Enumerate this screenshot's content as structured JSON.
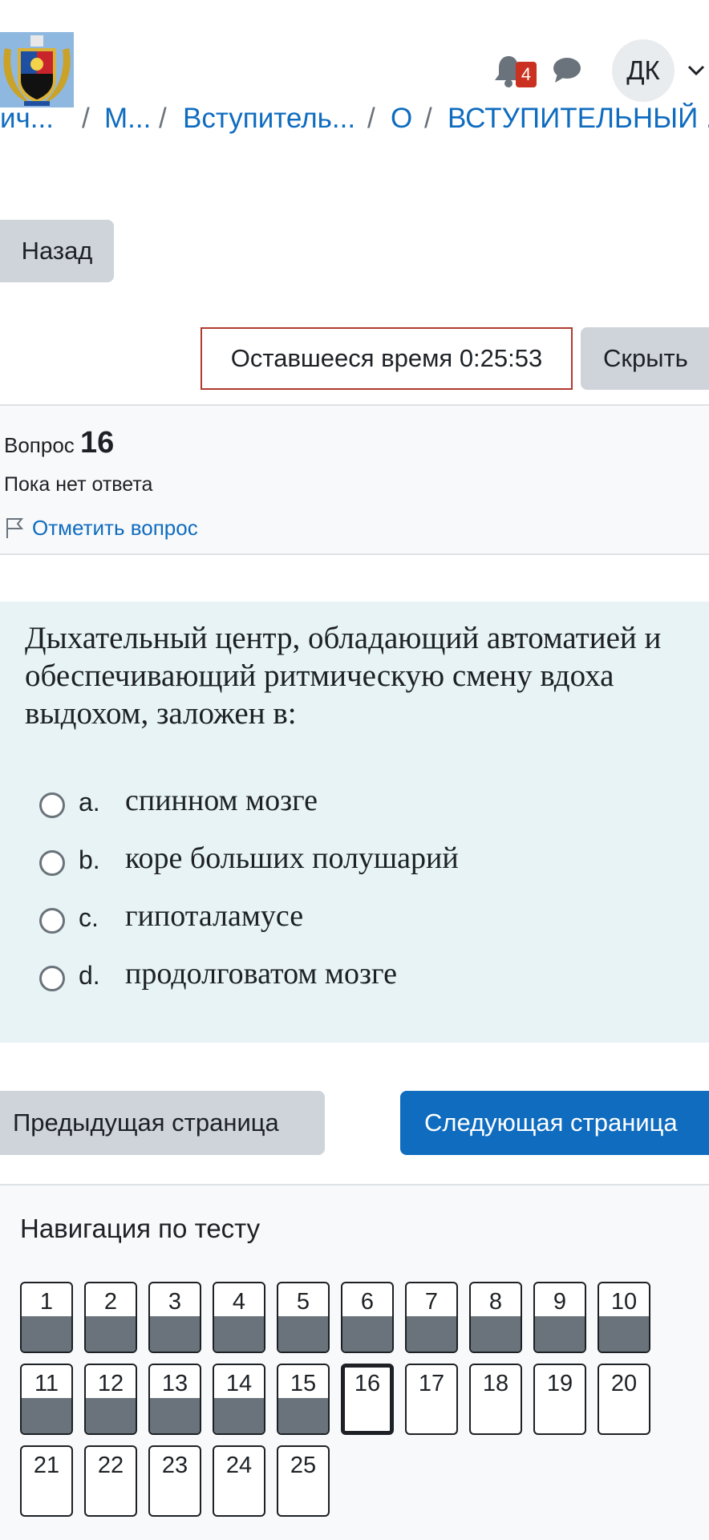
{
  "header": {
    "notifications_count": "4",
    "user_initials": "ДК"
  },
  "breadcrumb": [
    "ич...",
    "/",
    "М...",
    "/",
    "Вступитель...",
    "/",
    "О",
    "/",
    "ВСТУПИТЕЛЬНЫЙ ..."
  ],
  "back_label": "Назад",
  "timer": {
    "text": "Оставшееся время 0:25:53",
    "hide_label": "Скрыть"
  },
  "question_info": {
    "label": "Вопрос",
    "number": "16",
    "state": "Пока нет ответа",
    "flag_label": "Отметить вопрос"
  },
  "question": {
    "text": "Дыхательный центр, обладающий автоматией и обеспечивающий ритмическую смену вдоха выдохом, заложен в:",
    "answers": [
      {
        "letter": "a.",
        "text": "спинном мозге"
      },
      {
        "letter": "b.",
        "text": "коре больших полушарий"
      },
      {
        "letter": "c.",
        "text": "гипоталамусе"
      },
      {
        "letter": "d.",
        "text": "продолговатом мозге"
      }
    ]
  },
  "page_nav": {
    "prev_label": "Предыдущая страница",
    "next_label": "Следующая страница"
  },
  "quiz_nav": {
    "title": "Навигация по тесту",
    "buttons": [
      {
        "label": "1",
        "state": "answered"
      },
      {
        "label": "2",
        "state": "answered"
      },
      {
        "label": "3",
        "state": "answered"
      },
      {
        "label": "4",
        "state": "answered"
      },
      {
        "label": "5",
        "state": "answered"
      },
      {
        "label": "6",
        "state": "answered"
      },
      {
        "label": "7",
        "state": "answered"
      },
      {
        "label": "8",
        "state": "answered"
      },
      {
        "label": "9",
        "state": "answered"
      },
      {
        "label": "10",
        "state": "answered"
      },
      {
        "label": "11",
        "state": "answered"
      },
      {
        "label": "12",
        "state": "answered"
      },
      {
        "label": "13",
        "state": "answered"
      },
      {
        "label": "14",
        "state": "answered"
      },
      {
        "label": "15",
        "state": "answered"
      },
      {
        "label": "16",
        "state": "current"
      },
      {
        "label": "17",
        "state": "unanswered"
      },
      {
        "label": "18",
        "state": "unanswered"
      },
      {
        "label": "19",
        "state": "unanswered"
      },
      {
        "label": "20",
        "state": "unanswered"
      },
      {
        "label": "21",
        "state": "unanswered"
      },
      {
        "label": "22",
        "state": "unanswered"
      },
      {
        "label": "23",
        "state": "unanswered"
      },
      {
        "label": "24",
        "state": "unanswered"
      },
      {
        "label": "25",
        "state": "unanswered"
      }
    ]
  },
  "colors": {
    "brand_blue": "#0f6cbf",
    "badge_red": "#ca3120",
    "question_bg": "#e7f3f5",
    "answered_fill": "#6a737b"
  },
  "icons": [
    "university-logo",
    "bell-icon",
    "chat-icon",
    "chevron-down-icon",
    "flag-icon",
    "radio-icon"
  ]
}
